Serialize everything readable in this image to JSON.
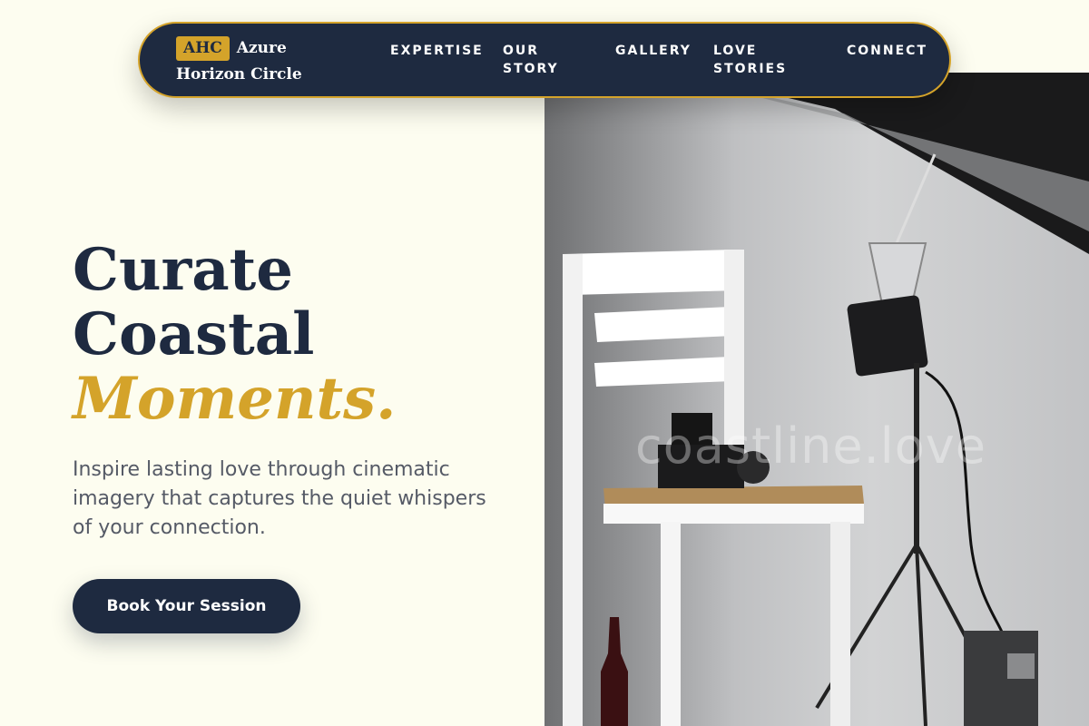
{
  "brand": {
    "badge": "AHC",
    "name": "Azure Horizon Circle"
  },
  "nav": {
    "expertise": "EXPERTISE",
    "our_story": "OUR STORY",
    "gallery": "GALLERY",
    "love_stories": "LOVE STORIES",
    "connect": "CONNECT"
  },
  "hero": {
    "line1": "Curate",
    "line2": "Coastal",
    "accent": "Moments.",
    "subtitle": "Inspire lasting love through cinematic imagery that captures the quiet whispers of your connection.",
    "cta": "Book Your Session"
  },
  "photo": {
    "watermark": "coastline.love",
    "alt": "Photo studio with white chair, camera, and studio light"
  },
  "colors": {
    "navy": "#1e2a40",
    "gold": "#d4a32a",
    "cream": "#fdfdf0"
  }
}
